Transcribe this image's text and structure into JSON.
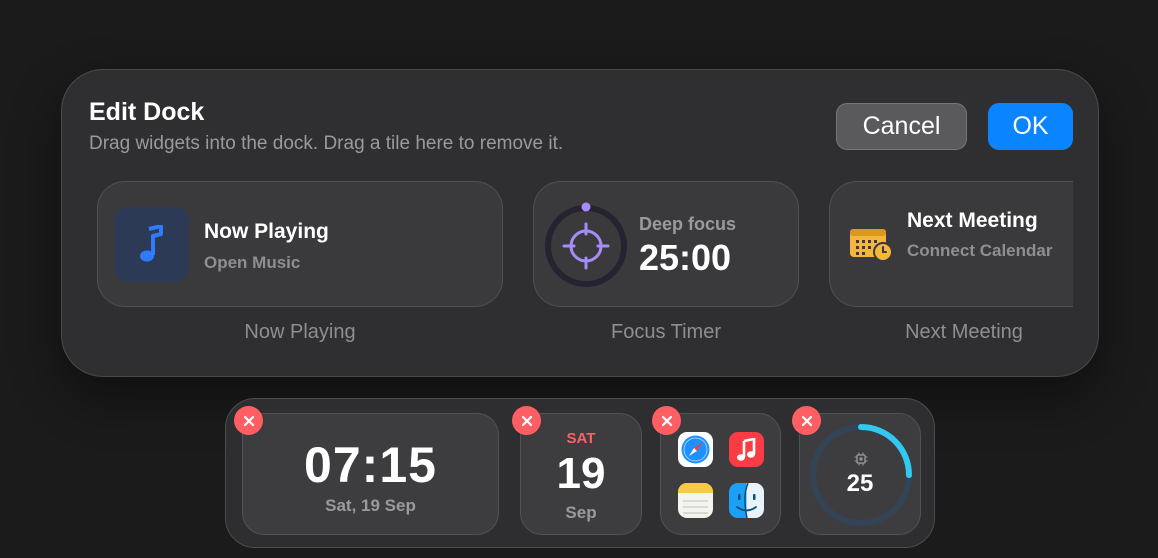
{
  "panel": {
    "title": "Edit Dock",
    "subtitle": "Drag widgets into the dock. Drag a tile here to remove it.",
    "cancel_label": "Cancel",
    "ok_label": "OK"
  },
  "widgets": {
    "now_playing": {
      "title": "Now Playing",
      "subtitle": "Open Music",
      "caption": "Now Playing",
      "icon": "music-note-icon"
    },
    "focus_timer": {
      "label": "Deep focus",
      "time": "25:00",
      "caption": "Focus Timer",
      "icon": "crosshair-icon"
    },
    "next_meeting": {
      "title": "Next Meeting",
      "subtitle": "Connect Calendar",
      "caption": "Next Meeting",
      "icon": "calendar-clock-icon"
    }
  },
  "dock": {
    "clock": {
      "time": "07:15",
      "date": "Sat, 19 Sep"
    },
    "calendar": {
      "weekday": "SAT",
      "day": "19",
      "month": "Sep"
    },
    "apps": [
      {
        "name": "Safari",
        "icon": "safari-icon"
      },
      {
        "name": "Music",
        "icon": "music-icon"
      },
      {
        "name": "Notes",
        "icon": "notes-icon"
      },
      {
        "name": "Finder",
        "icon": "finder-icon"
      }
    ],
    "cpu": {
      "value": "25",
      "fraction": 0.25,
      "icon": "chip-icon"
    }
  },
  "colors": {
    "accent": "#0a84ff",
    "remove": "#ff5f63",
    "focus": "#a78bfa",
    "meeting": "#f5b73b",
    "cpu": "#32c8f0"
  }
}
